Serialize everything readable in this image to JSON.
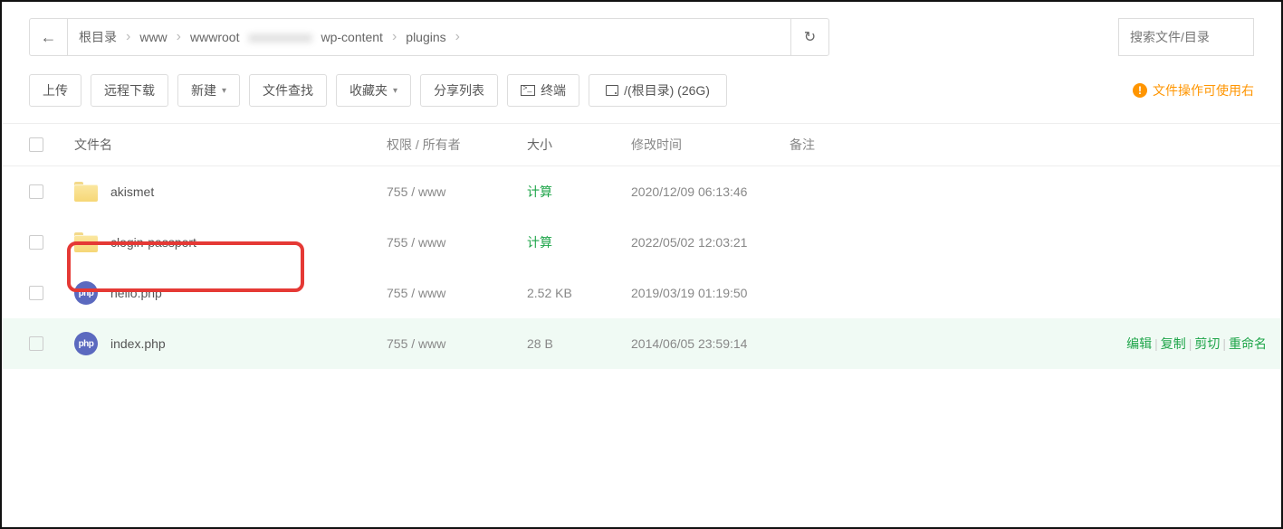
{
  "breadcrumb": {
    "items": [
      "根目录",
      "www",
      "wwwroot",
      "",
      "wp-content",
      "plugins"
    ]
  },
  "search": {
    "placeholder": "搜索文件/目录"
  },
  "toolbar": {
    "upload": "上传",
    "remote_download": "远程下载",
    "new": "新建",
    "file_find": "文件查找",
    "favorites": "收藏夹",
    "share_list": "分享列表",
    "terminal": "终端",
    "disk_info": "/(根目录) (26G)",
    "tip": "文件操作可使用右"
  },
  "columns": {
    "name": "文件名",
    "perm": "权限 / 所有者",
    "size": "大小",
    "mtime": "修改时间",
    "note": "备注"
  },
  "files": [
    {
      "type": "folder",
      "name": "akismet",
      "perm": "755 / www",
      "size_calc": "计算",
      "mtime": "2020/12/09 06:13:46"
    },
    {
      "type": "folder",
      "name": "clogin-passport",
      "perm": "755 / www",
      "size_calc": "计算",
      "mtime": "2022/05/02 12:03:21"
    },
    {
      "type": "php",
      "name": "hello.php",
      "perm": "755 / www",
      "size": "2.52 KB",
      "mtime": "2019/03/19 01:19:50"
    },
    {
      "type": "php",
      "name": "index.php",
      "perm": "755 / www",
      "size": "28 B",
      "mtime": "2014/06/05 23:59:14",
      "hover": true
    }
  ],
  "row_actions": {
    "edit": "编辑",
    "copy": "复制",
    "cut": "剪切",
    "rename": "重命名"
  }
}
